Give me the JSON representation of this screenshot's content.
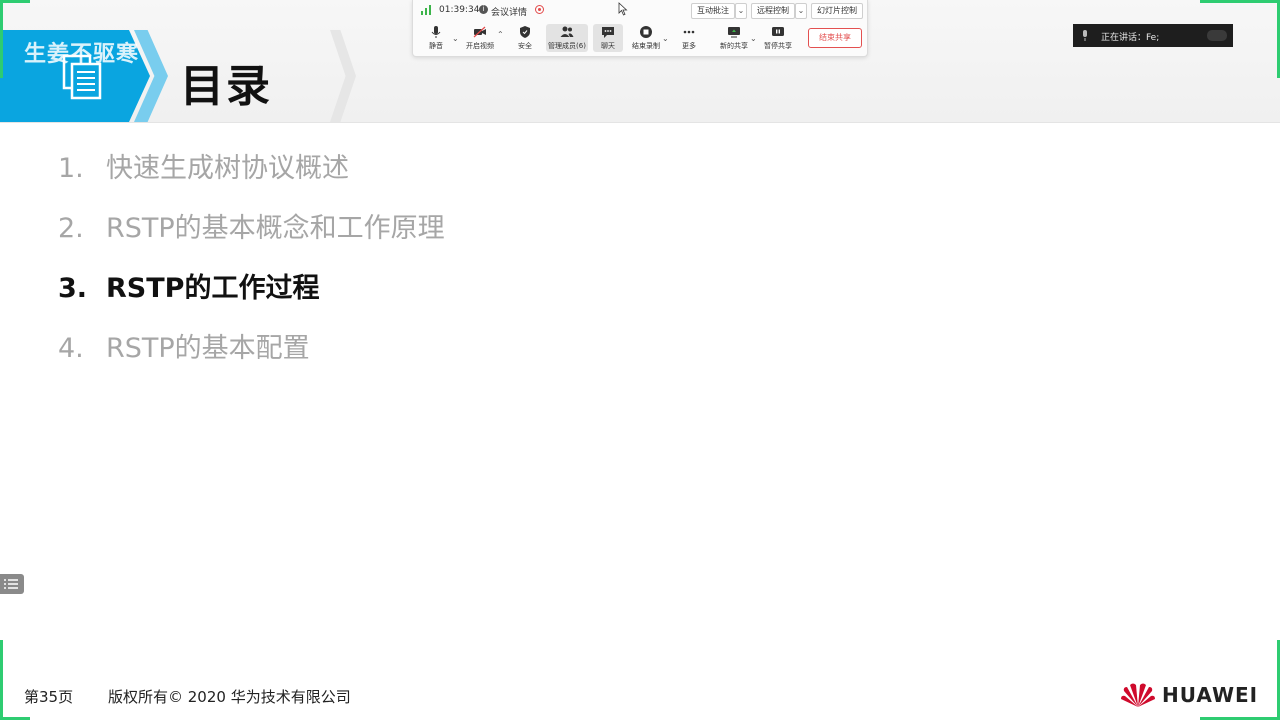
{
  "slide": {
    "watermark": "生姜不驱寒",
    "title": "目录",
    "agenda": [
      {
        "num": "1.",
        "text": "快速生成树协议概述",
        "active": false
      },
      {
        "num": "2.",
        "text": "RSTP的基本概念和工作原理",
        "active": false
      },
      {
        "num": "3.",
        "text": "RSTP的工作过程",
        "active": true
      },
      {
        "num": "4.",
        "text": "RSTP的基本配置",
        "active": false
      }
    ],
    "footer": {
      "page": "第35页",
      "copyright": "版权所有© 2020 华为技术有限公司",
      "brand": "HUAWEI"
    }
  },
  "meeting_bar": {
    "timer": "01:39:34",
    "meeting_details": "会议详情",
    "annotate": "互动批注",
    "remote_control": "远程控制",
    "slide_control": "幻灯片控制",
    "tools": {
      "mute": "静音",
      "video": "开启视频",
      "security": "安全",
      "members": "管理成员(6)",
      "chat": "聊天",
      "record": "结束录制",
      "more": "更多",
      "new_share": "新的共享",
      "pause_share": "暂停共享"
    },
    "end_share": "结束共享"
  },
  "speaking": {
    "label": "正在讲话：Fe;"
  },
  "colors": {
    "accent_blue": "#0aa5e0",
    "accent_green": "#2ecc71",
    "huawei_red": "#cf0a2c",
    "end_share_red": "#e35050"
  }
}
